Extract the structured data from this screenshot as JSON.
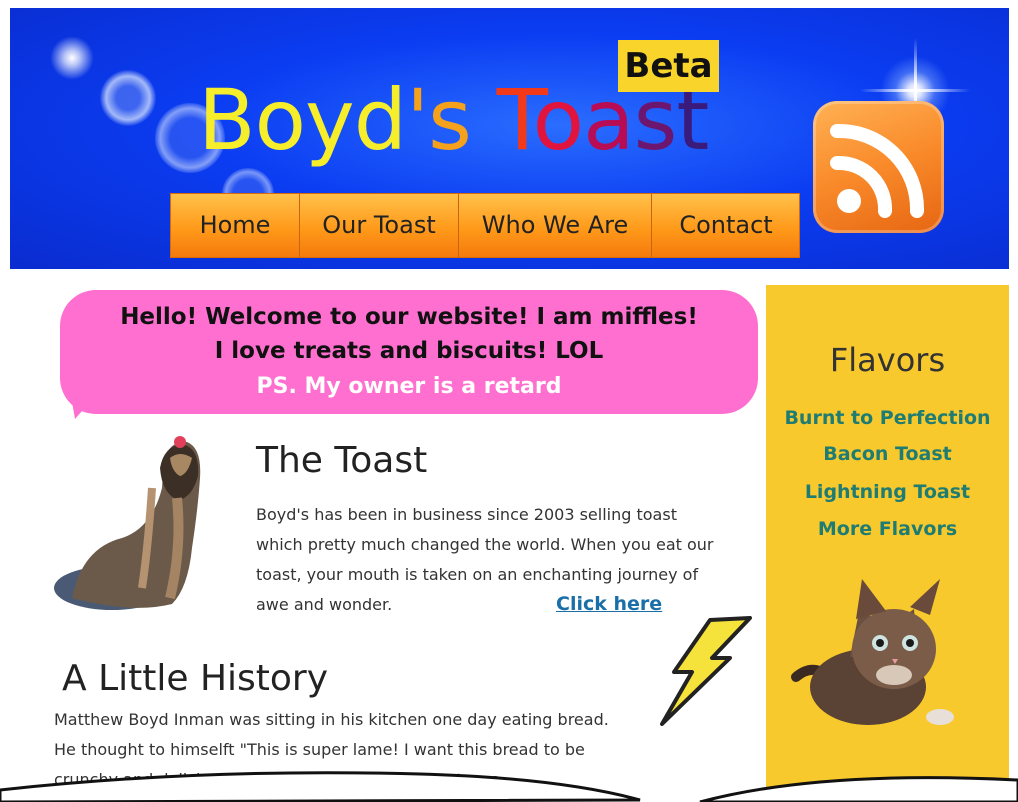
{
  "header": {
    "title_parts": [
      "Boyd",
      "'s",
      "T",
      "o",
      "a",
      "s",
      "t"
    ],
    "beta_label": "Beta",
    "nav": [
      "Home",
      "Our Toast",
      "Who We Are",
      "Contact"
    ],
    "rss_icon": "rss-icon"
  },
  "bubble": {
    "line1": "Hello! Welcome to our website!  I am miffles!",
    "line2": "I love treats and biscuits! LOL",
    "line3": "PS.  My owner is a retard"
  },
  "toast": {
    "title": "The Toast",
    "body": "Boyd's has been in business since 2003 selling toast which pretty much changed the world.  When you eat our toast, your mouth is taken on an enchanting journey of awe and wonder.",
    "link": "Click here"
  },
  "history": {
    "title": "A Little History",
    "body": "Matthew Boyd Inman was sitting in his kitchen one day eating bread.  He thought to himselft \"This is super lame! I want this bread to be crunchy and delicious!\" From then on, Boyd's toast was"
  },
  "sidebar": {
    "title": "Flavors",
    "flavors": [
      "Burnt to Perfection",
      "Bacon Toast",
      "Lightning Toast",
      "More Flavors"
    ]
  },
  "colors": {
    "header_bg": "#0b3df2",
    "nav_bg": "#ff9a1a",
    "bubble_bg": "#ff6fd0",
    "sidebar_bg": "#f8c92c",
    "flavor_link": "#1f7c72",
    "click_link": "#1a6fa8"
  }
}
